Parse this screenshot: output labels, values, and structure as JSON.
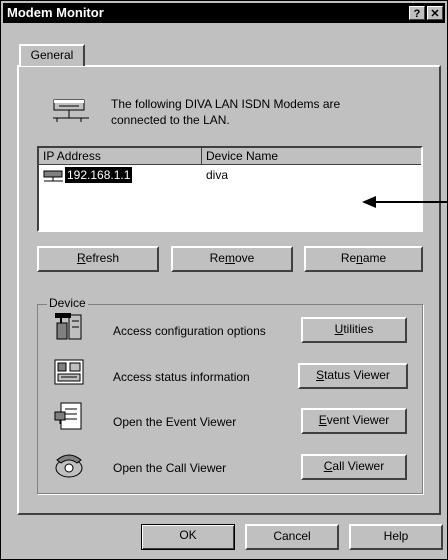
{
  "window": {
    "title": "Modem Monitor",
    "help_glyph": "?",
    "close_glyph": "✕"
  },
  "tabs": [
    {
      "label": "General"
    }
  ],
  "intro": {
    "line1": "The following DIVA LAN ISDN Modems are",
    "line2": "connected to the LAN."
  },
  "list": {
    "columns": [
      "IP Address",
      "Device Name"
    ],
    "rows": [
      {
        "ip": "192.168.1.1",
        "name": "diva"
      }
    ]
  },
  "buttons": {
    "refresh": {
      "mn": "R",
      "rest": "efresh"
    },
    "remove": {
      "pre": "Re",
      "mn": "m",
      "rest": "ove"
    },
    "rename": {
      "pre": "Re",
      "mn": "n",
      "rest": "ame"
    }
  },
  "device": {
    "label": "Device",
    "items": [
      {
        "text": "Access configuration options",
        "btn_mn": "U",
        "btn_rest": "tilities",
        "icon": "tools-icon"
      },
      {
        "text": "Access status information",
        "btn_mn": "S",
        "btn_rest": "tatus Viewer",
        "icon": "status-icon"
      },
      {
        "text": "Open the Event Viewer",
        "btn_mn": "E",
        "btn_rest": "vent Viewer",
        "icon": "event-log-icon"
      },
      {
        "text": "Open the Call Viewer",
        "btn_mn": "C",
        "btn_rest": "all Viewer",
        "icon": "telephone-icon"
      }
    ]
  },
  "footer": {
    "ok": "OK",
    "cancel": "Cancel",
    "help": "Help"
  }
}
